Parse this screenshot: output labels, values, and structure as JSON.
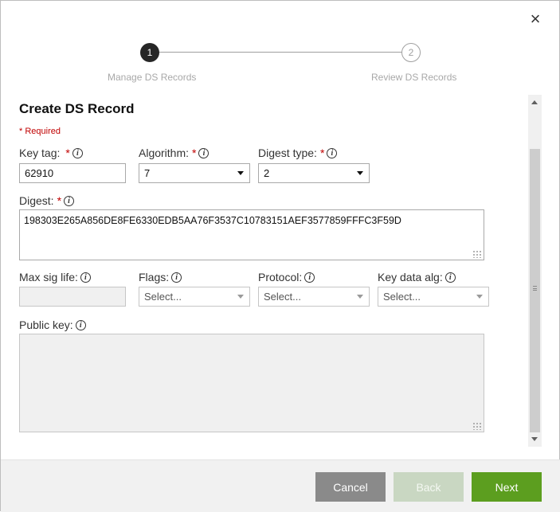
{
  "dialog": {
    "close_label": "×"
  },
  "stepper": {
    "steps": [
      {
        "number": "1",
        "label": "Manage DS Records",
        "state": "active"
      },
      {
        "number": "2",
        "label": "Review DS Records",
        "state": "inactive"
      }
    ]
  },
  "form": {
    "title": "Create DS Record",
    "required_note": "* Required",
    "key_tag": {
      "label": "Key tag:",
      "star": "*",
      "value": "62910"
    },
    "algorithm": {
      "label": "Algorithm:",
      "star": "*",
      "value": "7"
    },
    "digest_type": {
      "label": "Digest type:",
      "star": "*",
      "value": "2"
    },
    "digest": {
      "label": "Digest:",
      "star": "*",
      "value": "198303E265A856DE8FE6330EDB5AA76F3537C10783151AEF3577859FFFC3F59D"
    },
    "max_sig_life": {
      "label": "Max sig life:",
      "value": ""
    },
    "flags": {
      "label": "Flags:",
      "placeholder": "Select..."
    },
    "protocol": {
      "label": "Protocol:",
      "placeholder": "Select..."
    },
    "key_data_alg": {
      "label": "Key data alg:",
      "placeholder": "Select..."
    },
    "public_key": {
      "label": "Public key:",
      "value": ""
    }
  },
  "footer": {
    "cancel": "Cancel",
    "back": "Back",
    "next": "Next"
  },
  "icons": {
    "info": "i"
  },
  "colors": {
    "accent": "#5c9e1f",
    "required": "#c00000",
    "active_step": "#262626"
  }
}
